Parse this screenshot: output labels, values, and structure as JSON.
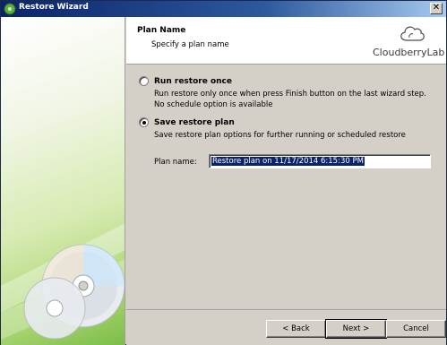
{
  "window": {
    "title": "Restore Wizard",
    "close_glyph": "✕"
  },
  "header": {
    "title": "Plan Name",
    "subtitle": "Specify a plan name",
    "logo_text": "CloudberryLab"
  },
  "options": {
    "run_once": {
      "label": "Run restore once",
      "description": "Run restore only once when press Finish button on the last wizard step. No schedule option is available",
      "checked": false
    },
    "save_plan": {
      "label": "Save restore plan",
      "description": "Save restore plan options for further running or scheduled restore",
      "checked": true
    }
  },
  "plan_name": {
    "label": "Plan name:",
    "value": "Restore plan on 11/17/2014 6:15:30 PM"
  },
  "buttons": {
    "back": "< Back",
    "next": "Next >",
    "cancel": "Cancel"
  },
  "icons": {
    "title": "restore-wizard-icon",
    "logo": "cloud-icon",
    "art": "cd-disc-icon"
  }
}
